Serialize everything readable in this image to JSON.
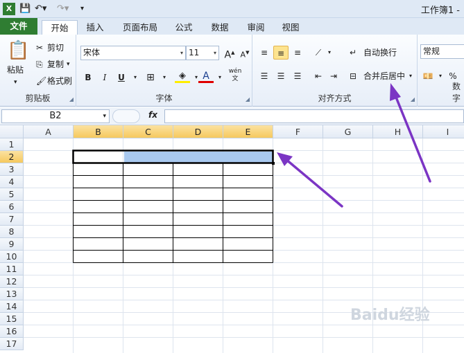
{
  "titlebar": {
    "app_title": "工作簿1 -"
  },
  "tabs": [
    {
      "label": "文件"
    },
    {
      "label": "开始"
    },
    {
      "label": "插入"
    },
    {
      "label": "页面布局"
    },
    {
      "label": "公式"
    },
    {
      "label": "数据"
    },
    {
      "label": "审阅"
    },
    {
      "label": "视图"
    }
  ],
  "clipboard": {
    "paste": "粘贴",
    "cut": "剪切",
    "copy": "复制",
    "format_painter": "格式刷",
    "label": "剪贴板"
  },
  "font": {
    "name": "宋体",
    "size": "11",
    "bold": "B",
    "italic": "I",
    "underline": "U",
    "phonetic": "wén",
    "label": "字体"
  },
  "alignment": {
    "wrap_text": "自动换行",
    "merge_center": "合并后居中",
    "label": "对齐方式"
  },
  "number": {
    "format": "常规",
    "percent": "%",
    "label": "数字"
  },
  "formula_bar": {
    "name_box": "B2",
    "fx": "fx",
    "value": ""
  },
  "grid": {
    "columns": [
      "A",
      "B",
      "C",
      "D",
      "E",
      "F",
      "G",
      "H",
      "I"
    ],
    "rows": [
      "1",
      "2",
      "3",
      "4",
      "5",
      "6",
      "7",
      "8",
      "9",
      "10",
      "11",
      "12",
      "13",
      "14",
      "15",
      "16",
      "17"
    ],
    "active_cell": "B2"
  },
  "watermark": "Baidu经验",
  "colors": {
    "accent": "#2f7d32",
    "selection": "#a9c9ef",
    "annotation": "#7b35c4"
  }
}
